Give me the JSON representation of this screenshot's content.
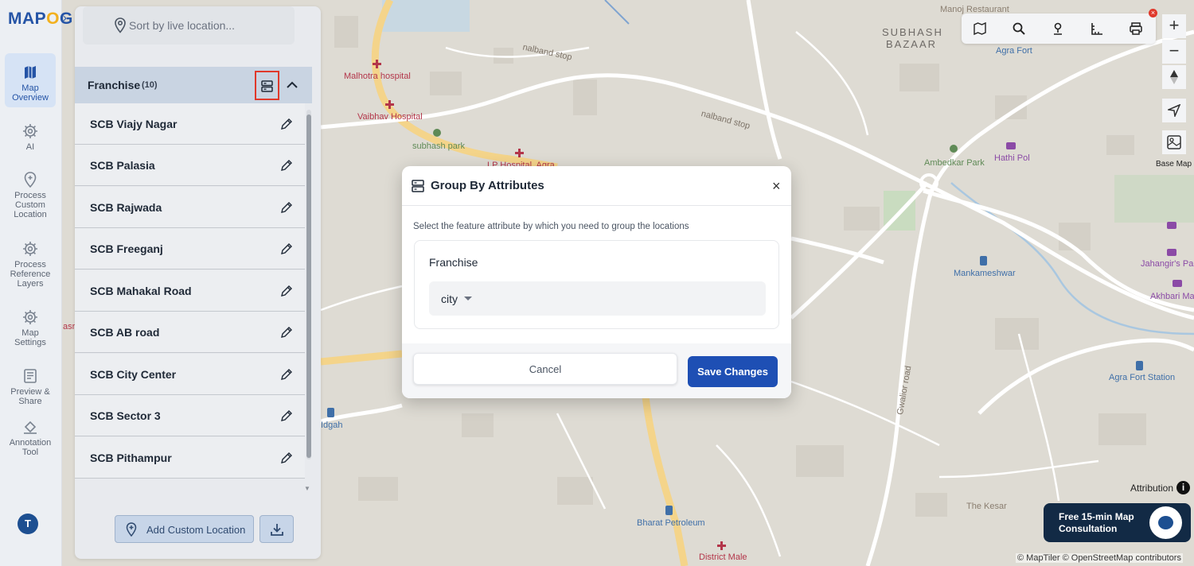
{
  "app": {
    "logo_text": "MAPOG",
    "logo_part1": "MAP",
    "logo_part2": "O",
    "logo_part3": "G"
  },
  "rail": {
    "items": [
      {
        "label": "Map Overview",
        "icon": "map-icon",
        "active": true
      },
      {
        "label": "AI",
        "icon": "gear-icon"
      },
      {
        "label": "Process Custom Location",
        "icon": "location-pin-icon"
      },
      {
        "label": "Process Reference Layers",
        "icon": "gear-icon"
      },
      {
        "label": "Map Settings",
        "icon": "gear-icon"
      },
      {
        "label": "Preview & Share",
        "icon": "preview-icon"
      },
      {
        "label": "Annotation Tool",
        "icon": "paint-bucket-icon"
      }
    ],
    "avatar_initial": "T"
  },
  "panel": {
    "search_placeholder": "Sort by live location...",
    "group": {
      "title": "Franchise",
      "count": "(10)"
    },
    "items": [
      "SCB Viajy Nagar",
      "SCB Palasia",
      "SCB Rajwada",
      "SCB Freeganj",
      "SCB Mahakal Road",
      "SCB AB road",
      "SCB City Center",
      "SCB Sector 3",
      "SCB Pithampur"
    ],
    "add_location_label": "Add Custom Location"
  },
  "map": {
    "labels": {
      "manoj": "Manoj Restaurant",
      "subhash_bazaar_1": "SUBHASH",
      "subhash_bazaar_2": "BAZAAR",
      "agra_fort": "Agra Fort",
      "malhotra": "Malhotra hospital",
      "vaibhav": "Vaibhav Hospital",
      "subhash_park": "subhash park",
      "lp_hospital": "LP Hospital, Agra",
      "nalband1": "nalband stop",
      "nalband2": "nalband stop",
      "ambedkar": "Ambedkar Park",
      "hathi_pol": "Hathi Pol",
      "mankameshwar": "Mankameshwar",
      "jahangir": "Jahangir's Pal",
      "akhbari": "Akhbari Ma",
      "agra_fort_station": "Agra Fort Station",
      "gwalior_road": "Gwalior road",
      "bharat": "Bharat Petroleum",
      "the_kesar": "The Kesar",
      "district_male": "District Male",
      "idgah": "Idgah",
      "asr": "asr"
    },
    "basemap_label": "Base Map",
    "attribution_label": "Attribution",
    "credits": "© MapTiler © OpenStreetMap contributors",
    "consult": {
      "line1": "Free 15-min Map",
      "line2": "Consultation"
    },
    "colors": {
      "map_bg": "#dedbd3",
      "road": "#ffffff",
      "road_yellow": "#f4d48a",
      "water": "#a9c7e0",
      "park": "#c9dcc0"
    }
  },
  "modal": {
    "title": "Group By Attributes",
    "description": "Select the feature attribute by which you need to group the locations",
    "layer_label": "Franchise",
    "selected_attribute": "city",
    "cancel_label": "Cancel",
    "save_label": "Save Changes",
    "close_symbol": "×"
  },
  "colors": {
    "accent": "#1e4fb4",
    "brand_blue": "#2554a6",
    "brand_yellow": "#f2b01e",
    "highlight_red": "#e0392b"
  }
}
